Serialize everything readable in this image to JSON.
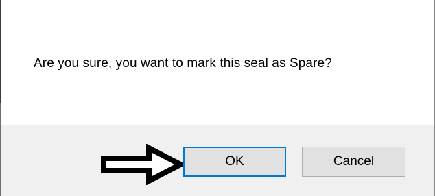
{
  "dialog": {
    "message": "Are you sure, you want to mark this seal as Spare?",
    "ok_label": "OK",
    "cancel_label": "Cancel"
  },
  "icons": {
    "arrow": "arrow-right-outline-icon"
  },
  "colors": {
    "ok_focus_border": "#0078d7",
    "button_face": "#e1e1e1",
    "footer_background": "#f0f0f0"
  }
}
